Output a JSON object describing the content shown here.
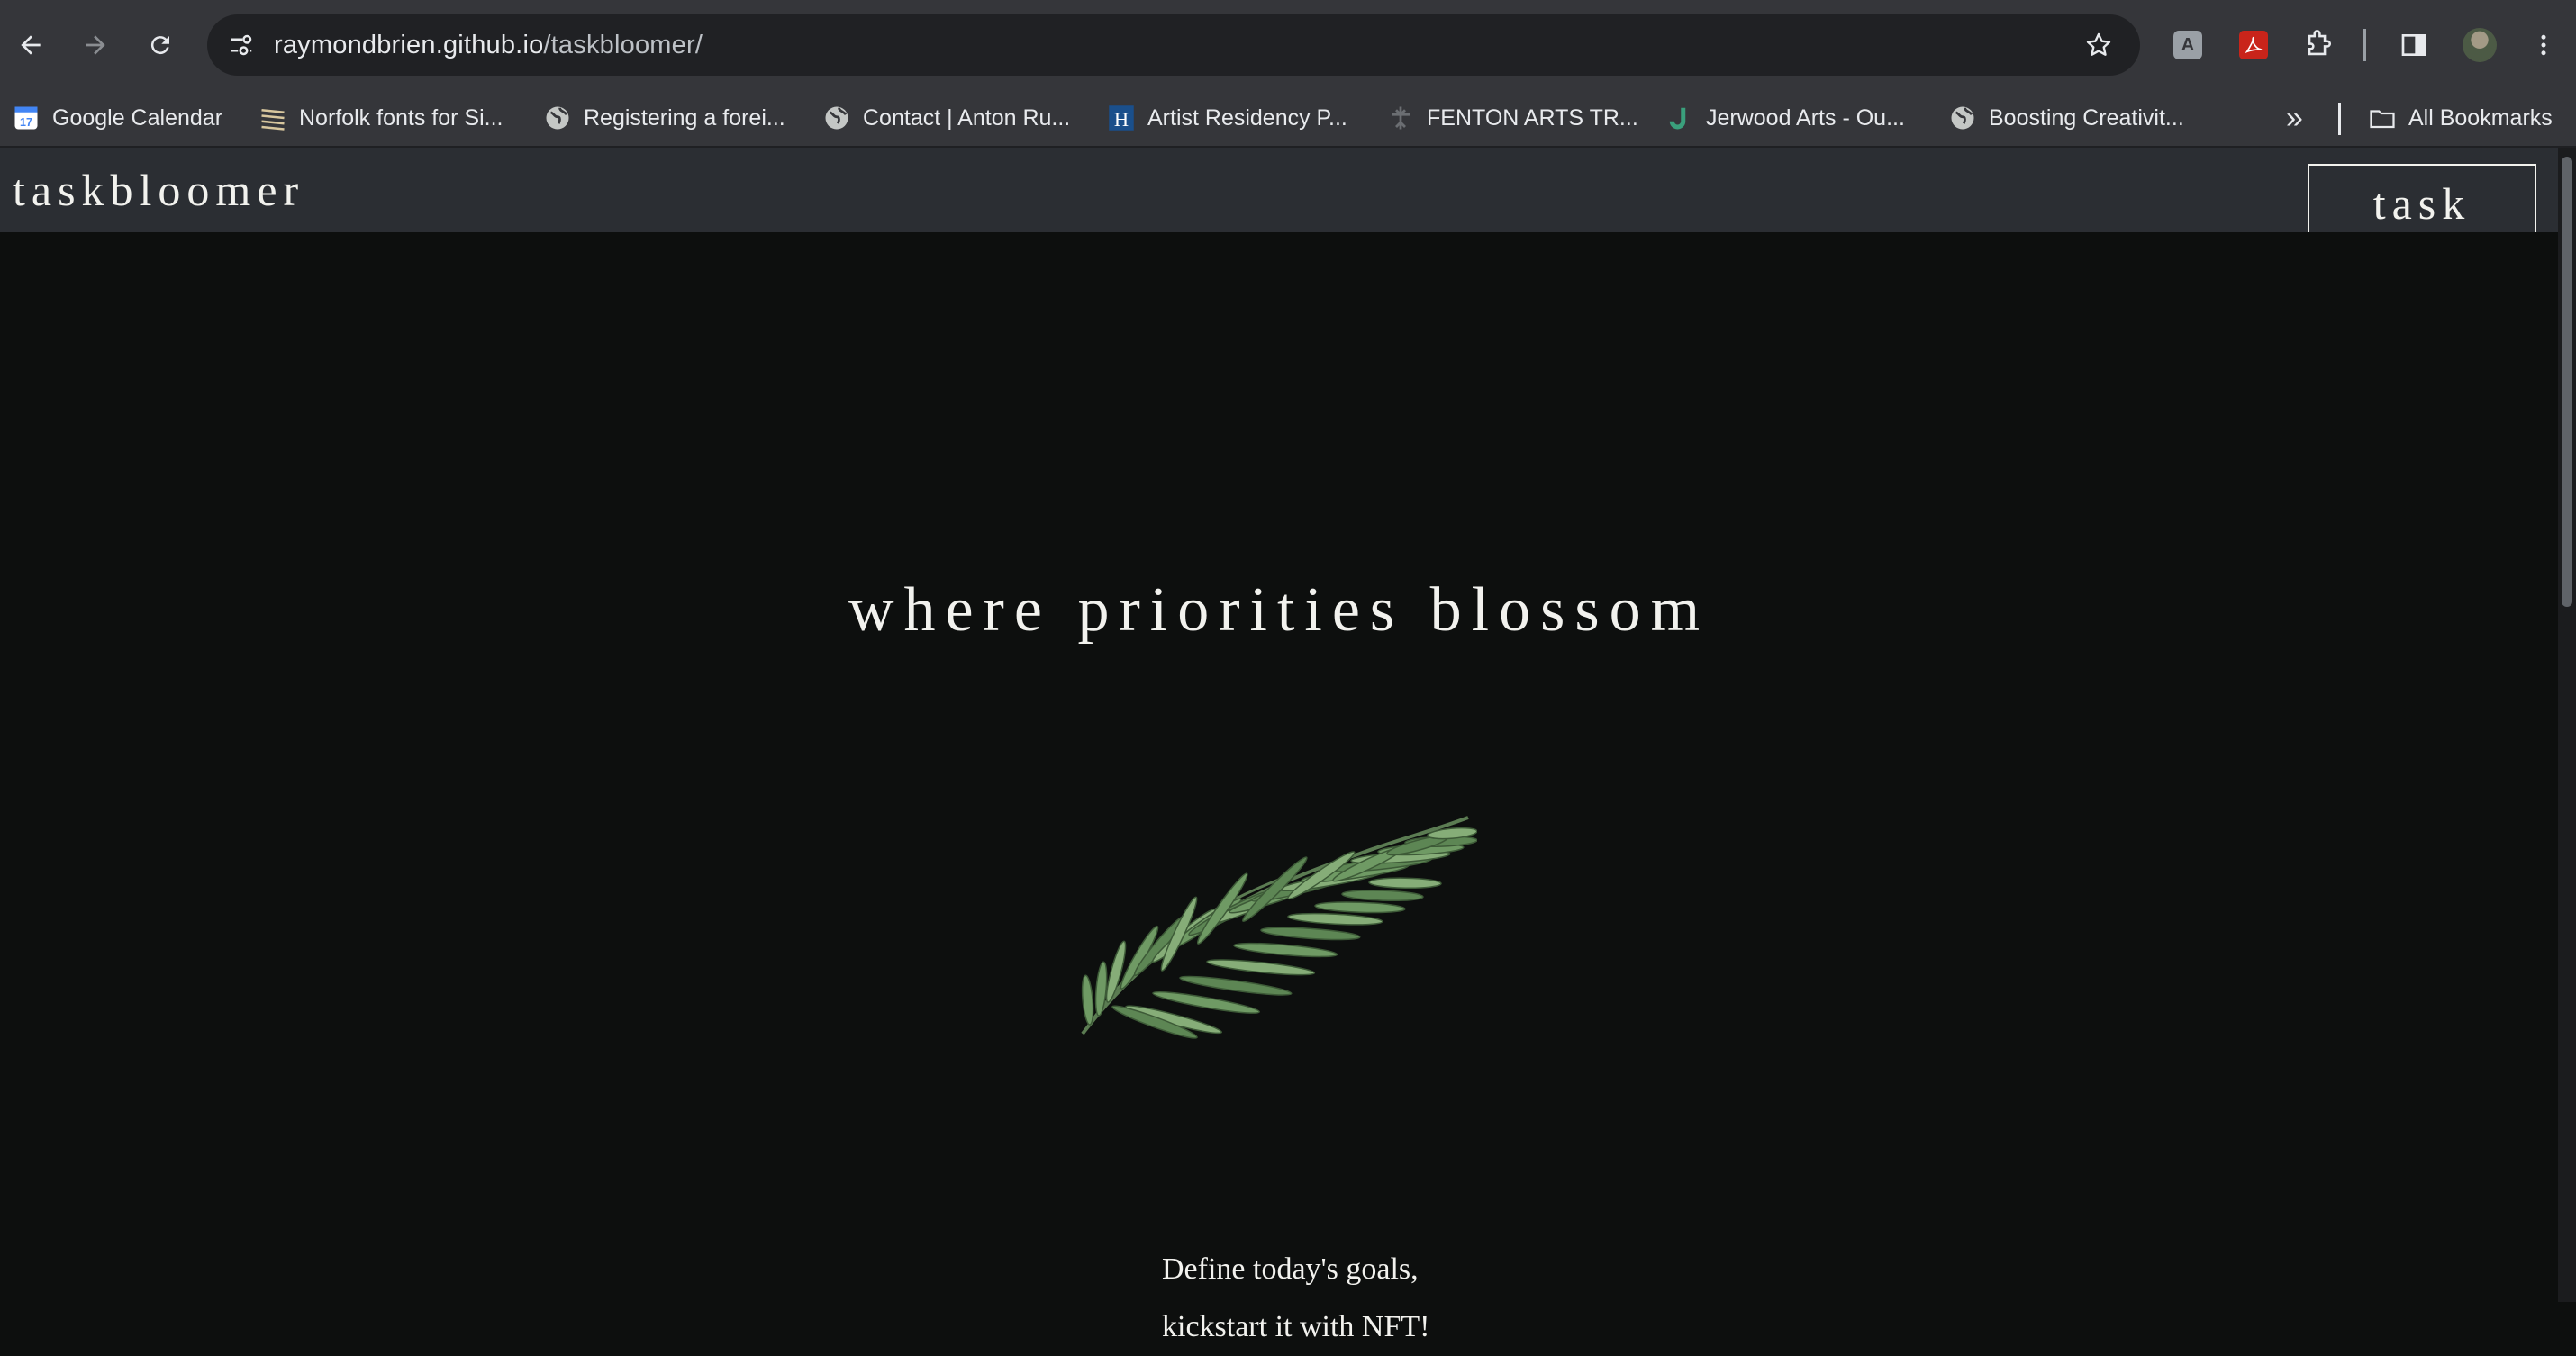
{
  "browser": {
    "url_host": "raymondbrien.github.io",
    "url_path": "/taskbloomer/",
    "bookmarks": [
      {
        "label": "Google Calendar",
        "icon": "calendar-icon"
      },
      {
        "label": "Norfolk fonts for Si...",
        "icon": "stripes-icon"
      },
      {
        "label": "Registering a forei...",
        "icon": "globe-icon"
      },
      {
        "label": "Contact | Anton Ru...",
        "icon": "globe-icon"
      },
      {
        "label": "Artist Residency P...",
        "icon": "h-letter-icon"
      },
      {
        "label": "FENTON ARTS TR...",
        "icon": "cross-icon"
      },
      {
        "label": "Jerwood Arts - Ou...",
        "icon": "j-letter-icon"
      },
      {
        "label": "Boosting Creativit...",
        "icon": "globe-icon"
      }
    ],
    "all_bookmarks_label": "All Bookmarks",
    "more_label": "»"
  },
  "page": {
    "brand": "taskbloomer",
    "nav_link": "task page",
    "tagline": "where priorities blossom",
    "intro_line1": "Define today's goals,",
    "intro_line2": "kickstart it with NFT!"
  },
  "colors": {
    "page_bg": "#0d0f0e",
    "header_bg": "#2b2e33",
    "text": "#f2f2ee",
    "leaf": "#6f9a64"
  }
}
